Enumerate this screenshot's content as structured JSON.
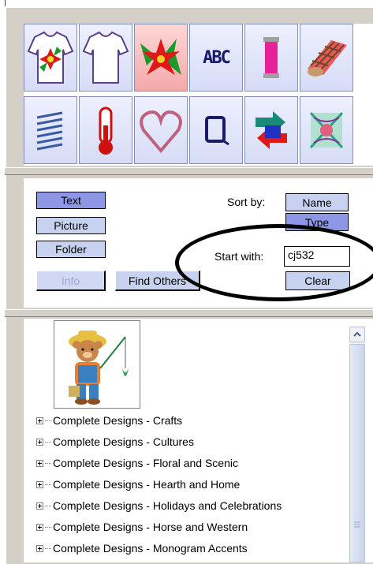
{
  "toolbar": {
    "icons": [
      "shirt-flower-icon",
      "shirt-outline-icon",
      "poinsettia-icon",
      "abc-lettering-icon",
      "thread-spool-icon",
      "fabric-roll-icon",
      "spring-stitch-icon",
      "thermometer-icon",
      "heart-outline-icon",
      "square-outline-icon",
      "arrows-rotate-icon",
      "pattern-swatch-icon"
    ],
    "abc_text": "ABC"
  },
  "filters": {
    "text": "Text",
    "picture": "Picture",
    "folder": "Folder",
    "info": "Info",
    "find_others": "Find Others"
  },
  "sort": {
    "label": "Sort by:",
    "name": "Name",
    "type": "Type"
  },
  "start": {
    "label": "Start with:",
    "value": "cj532",
    "clear": "Clear"
  },
  "tree": {
    "items": [
      "Complete Designs - Crafts",
      "Complete Designs - Cultures",
      "Complete Designs - Floral and Scenic",
      "Complete Designs - Hearth and Home",
      "Complete Designs - Holidays and Celebrations",
      "Complete Designs - Horse and Western",
      "Complete Designs - Monogram Accents"
    ]
  },
  "colors": {
    "selected_button": "#8d97e6",
    "button": "#c6d2f0",
    "frame": "#d4d0c8"
  }
}
